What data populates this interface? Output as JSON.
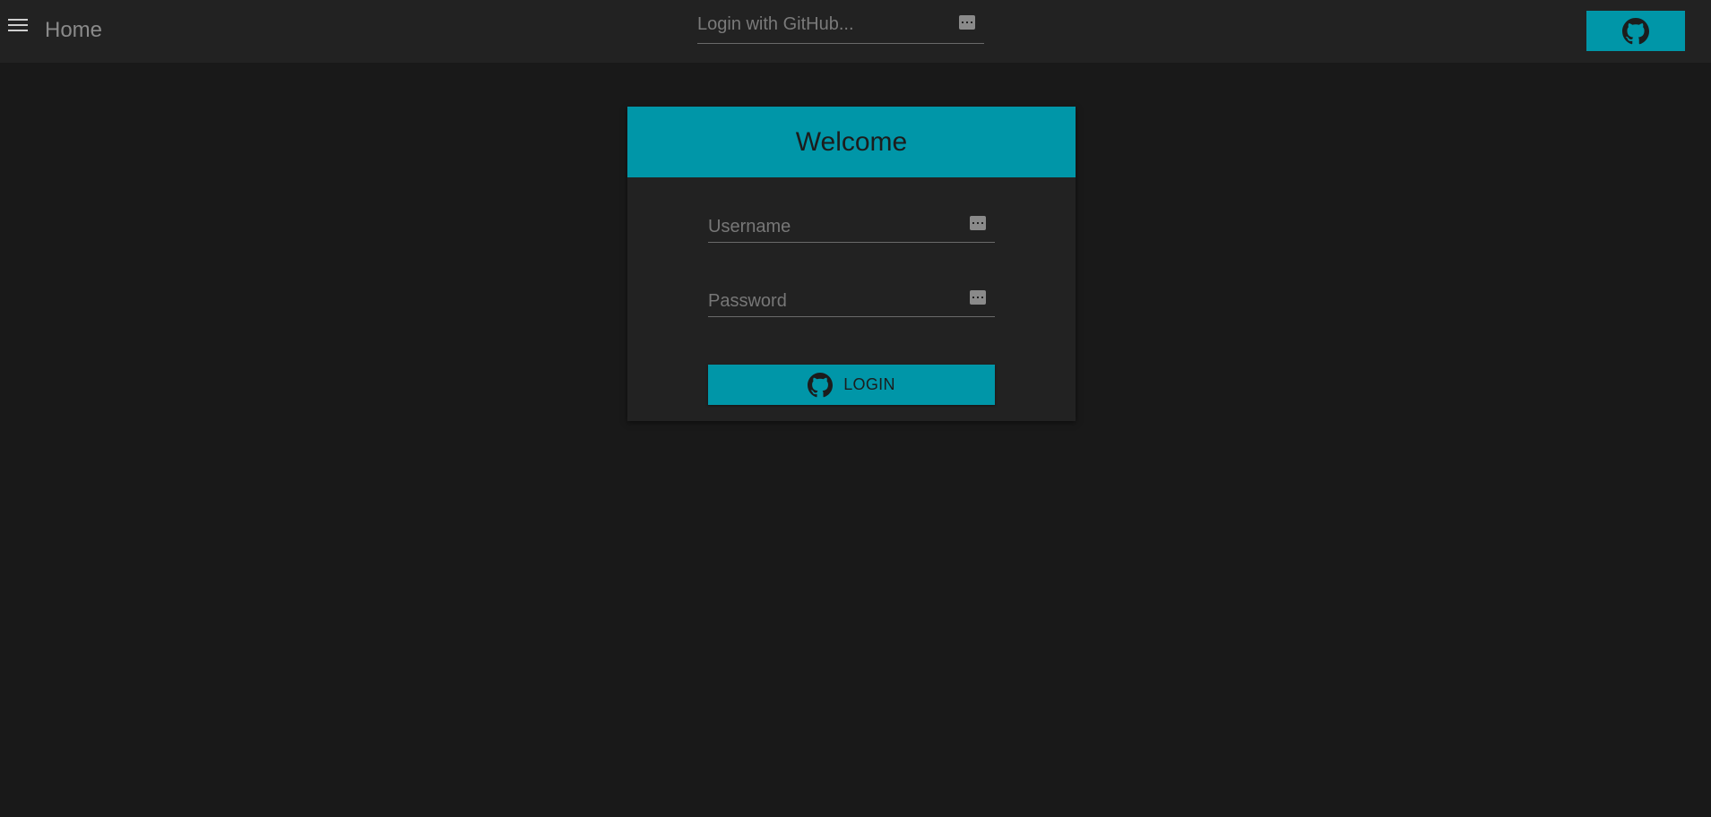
{
  "header": {
    "menu_icon": "hamburger-menu-icon",
    "title": "Home",
    "search": {
      "placeholder": "Login with GitHub...",
      "value": ""
    },
    "github_button_icon": "github-icon"
  },
  "card": {
    "title": "Welcome",
    "username": {
      "placeholder": "Username",
      "value": ""
    },
    "password": {
      "placeholder": "Password",
      "value": ""
    },
    "login_label": "LOGIN",
    "login_icon": "github-icon"
  },
  "colors": {
    "accent": "#0096a8",
    "background": "#191919",
    "surface": "#222222"
  }
}
